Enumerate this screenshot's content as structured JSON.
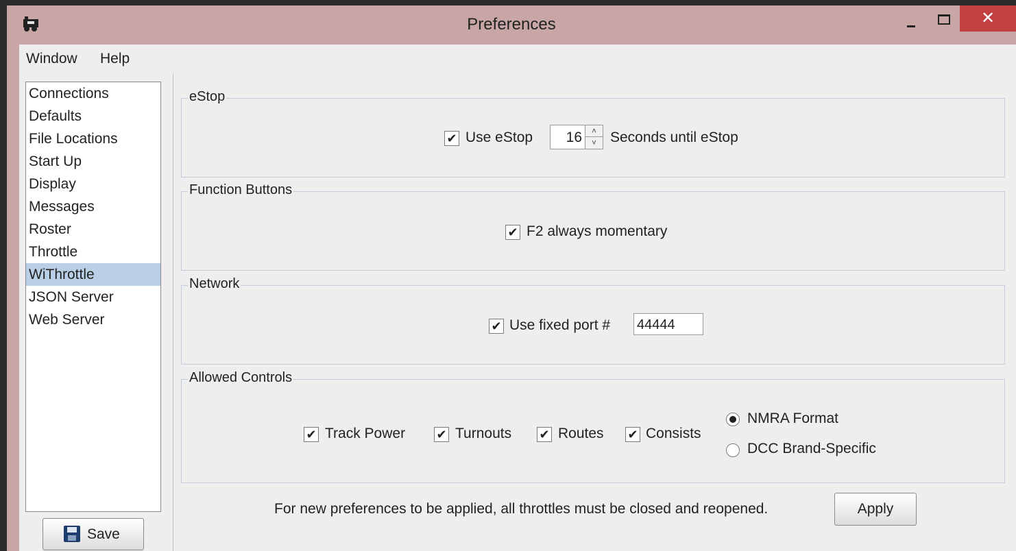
{
  "window": {
    "title": "Preferences",
    "close_glyph": "✕",
    "icons": [
      "app-icon",
      "minimize-icon",
      "maximize-icon",
      "close-icon"
    ]
  },
  "menubar": {
    "items": [
      "Window",
      "Help"
    ]
  },
  "sidebar": {
    "items": [
      "Connections",
      "Defaults",
      "File Locations",
      "Start Up",
      "Display",
      "Messages",
      "Roster",
      "Throttle",
      "WiThrottle",
      "JSON Server",
      "Web Server"
    ],
    "selected": "WiThrottle",
    "save_label": "Save",
    "save_icon": "floppy-disk-icon"
  },
  "estop": {
    "title": "eStop",
    "checkbox_label": "Use eStop",
    "checked": true,
    "seconds_value": "16",
    "seconds_label": "Seconds until eStop",
    "spin_up": "˄",
    "spin_down": "˅"
  },
  "function_buttons": {
    "title": "Function Buttons",
    "f2_label": "F2 always momentary",
    "checked": true
  },
  "network": {
    "title": "Network",
    "fixed_port_label": "Use fixed port #",
    "checked": true,
    "port_value": "44444"
  },
  "allowed_controls": {
    "title": "Allowed Controls",
    "checkboxes": [
      "Track Power",
      "Turnouts",
      "Routes",
      "Consists"
    ],
    "checked": [
      true,
      true,
      true,
      true
    ],
    "radios": [
      "NMRA Format",
      "DCC Brand-Specific"
    ],
    "radio_selected": "NMRA Format"
  },
  "check_glyph": "✔",
  "footer": {
    "note": "For new preferences to be applied, all throttles must be closed and reopened.",
    "apply_label": "Apply"
  },
  "colors": {
    "titlebar": "#c8a6a6",
    "close_button": "#c44141",
    "selected_item": "#b8cfe5",
    "panel_bg": "#eeeeee"
  }
}
